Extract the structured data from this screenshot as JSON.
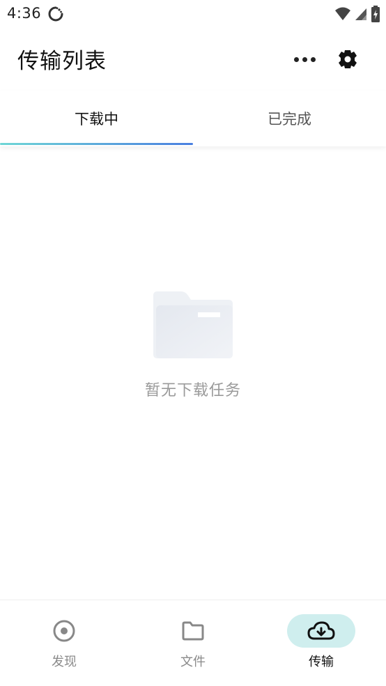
{
  "status_bar": {
    "time": "4:36",
    "icons": [
      "sync-icon",
      "wifi-icon",
      "signal-icon",
      "battery-charging-icon"
    ]
  },
  "header": {
    "title": "传输列表",
    "more_icon": "more-horizontal-icon",
    "settings_icon": "gear-icon"
  },
  "tabs": [
    {
      "label": "下载中",
      "active": true
    },
    {
      "label": "已完成",
      "active": false
    }
  ],
  "colors": {
    "indicator_start": "#6fd6d6",
    "indicator_end": "#4a7fe0",
    "active_nav_bg": "#cfeeee",
    "muted_text": "#9a9a9a"
  },
  "empty_state": {
    "icon": "folder-icon",
    "message": "暂无下载任务"
  },
  "bottom_nav": [
    {
      "label": "发现",
      "icon": "discover-icon",
      "active": false
    },
    {
      "label": "文件",
      "icon": "folder-icon",
      "active": false
    },
    {
      "label": "传输",
      "icon": "cloud-download-icon",
      "active": true
    }
  ]
}
